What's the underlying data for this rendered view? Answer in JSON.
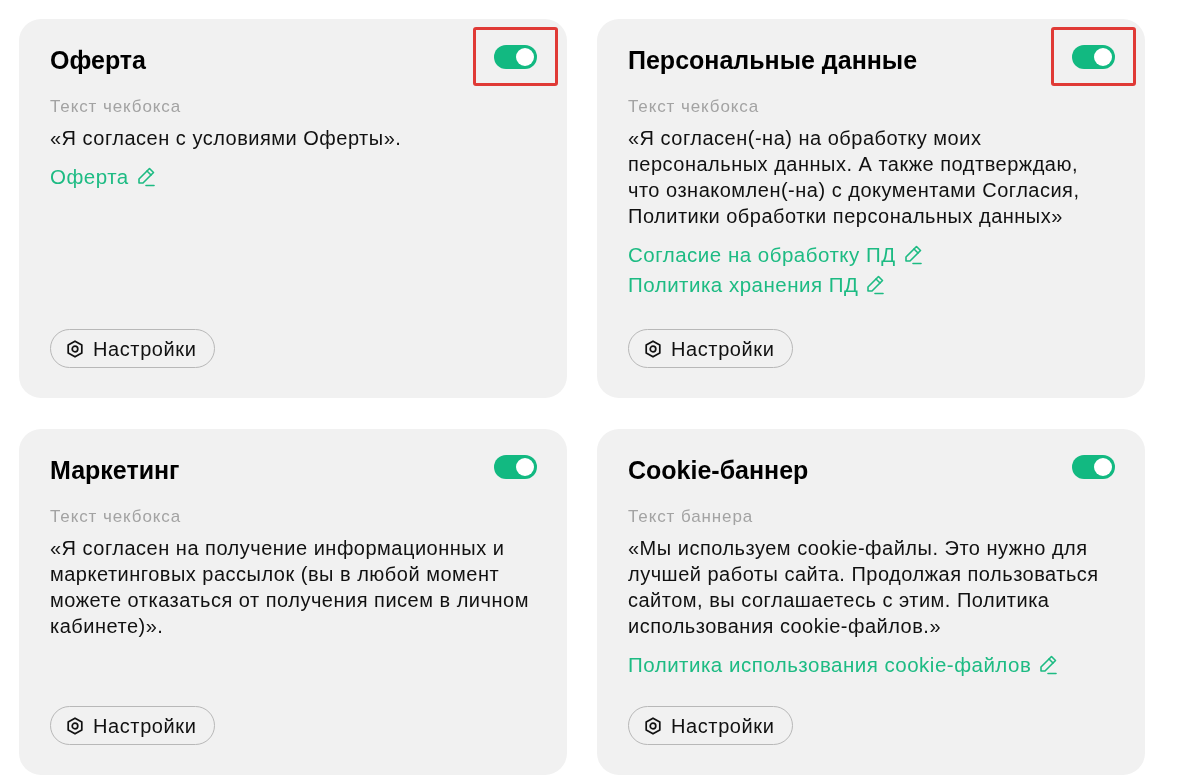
{
  "cards": [
    {
      "title": "Оферта",
      "toggle": {
        "on": true,
        "highlighted": true
      },
      "text_label": "Текст чекбокса",
      "text": "«Я согласен с условиями Оферты».",
      "links": [
        "Оферта"
      ],
      "settings_button": "Настройки"
    },
    {
      "title": "Персональные данные",
      "toggle": {
        "on": true,
        "highlighted": true
      },
      "text_label": "Текст чекбокса",
      "text": "«Я согласен(-на) на обработку моих персональных данных. А также подтверждаю, что ознакомлен(-на) с документами Согласия, Политики обработки персональных данных»",
      "links": [
        "Согласие на обработку ПД",
        "Политика хранения ПД"
      ],
      "settings_button": "Настройки"
    },
    {
      "title": "Маркетинг",
      "toggle": {
        "on": true,
        "highlighted": false
      },
      "text_label": "Текст чекбокса",
      "text": "«Я согласен на получение информационных и маркетинговых рассылок (вы в любой момент можете отказаться от получения писем в личном кабинете)».",
      "settings_button": "Настройки"
    },
    {
      "title": "Cookie-баннер",
      "toggle": {
        "on": true,
        "highlighted": false
      },
      "text_label": "Текст баннера",
      "text": "«Мы используем cookie-файлы. Это нужно для лучшей работы сайта. Продолжая пользоваться сайтом, вы соглашаетесь с этим. Политика использования cookie-файлов.»",
      "links": [
        "Политика использования cookie-файлов"
      ],
      "settings_button": "Настройки"
    }
  ]
}
